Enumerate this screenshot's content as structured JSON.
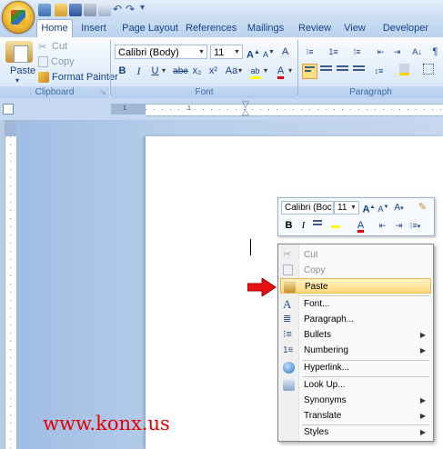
{
  "tabs": [
    "Home",
    "Insert",
    "Page Layout",
    "References",
    "Mailings",
    "Review",
    "View",
    "Developer"
  ],
  "clipboard": {
    "paste_label": "Paste",
    "cut_label": "Cut",
    "copy_label": "Copy",
    "format_painter_label": "Format Painter",
    "group_label": "Clipboard"
  },
  "font": {
    "font_name": "Calibri (Body)",
    "font_size": "11",
    "group_label": "Font",
    "bold": "B",
    "italic": "I",
    "underline": "U",
    "strike": "abe",
    "subscript": "x₂",
    "superscript": "x²",
    "change_case": "Aa",
    "grow": "A˄",
    "shrink": "A˅",
    "clear": "A"
  },
  "paragraph": {
    "group_label": "Paragraph"
  },
  "mini_toolbar": {
    "font_name": "Calibri (Boc",
    "font_size": "11",
    "bold": "B",
    "italic": "I"
  },
  "context_menu": {
    "items": [
      {
        "label": "Cut",
        "icon": "scissors-icon",
        "enabled": false
      },
      {
        "label": "Copy",
        "icon": "copy-icon",
        "enabled": false
      },
      {
        "label": "Paste",
        "icon": "paste-icon",
        "enabled": true,
        "highlighted": true
      },
      {
        "label": "Font...",
        "icon": "font-icon",
        "enabled": true
      },
      {
        "label": "Paragraph...",
        "icon": "paragraph-icon",
        "enabled": true
      },
      {
        "label": "Bullets",
        "icon": "bullets-icon",
        "enabled": true,
        "submenu": true
      },
      {
        "label": "Numbering",
        "icon": "numbering-icon",
        "enabled": true,
        "submenu": true
      },
      {
        "label": "Hyperlink...",
        "icon": "hyperlink-icon",
        "enabled": true
      },
      {
        "label": "Look Up...",
        "icon": "lookup-icon",
        "enabled": true
      },
      {
        "label": "Synonyms",
        "icon": "",
        "enabled": true,
        "submenu": true
      },
      {
        "label": "Translate",
        "icon": "",
        "enabled": true,
        "submenu": true
      },
      {
        "label": "Styles",
        "icon": "",
        "enabled": true,
        "submenu": true
      }
    ]
  },
  "watermark": "www.konx.us",
  "colors": {
    "highlight_yellow": "#ffd87a",
    "font_red": "#e60000",
    "ribbon_blue": "#15428b"
  }
}
